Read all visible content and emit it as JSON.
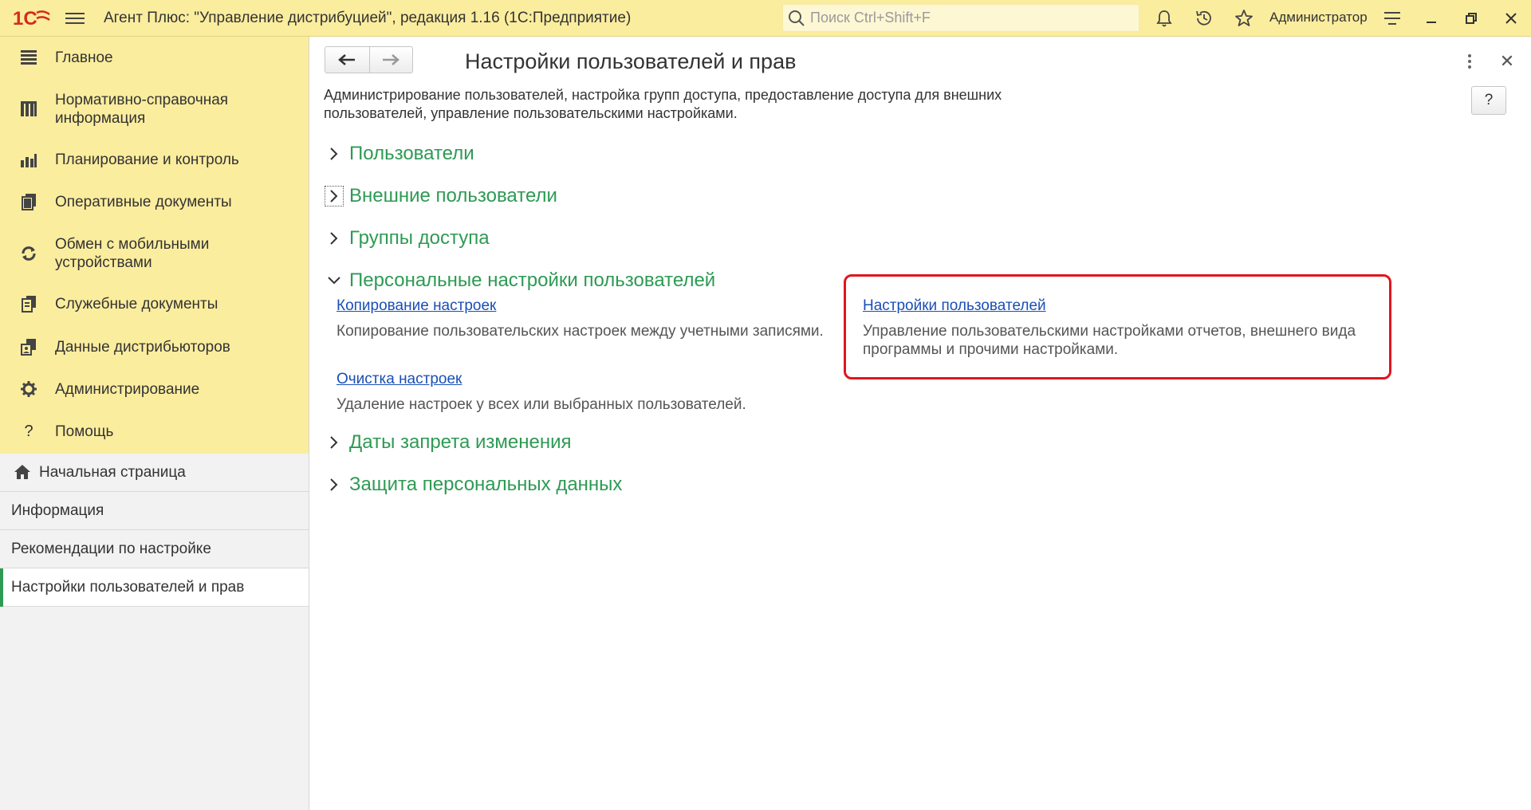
{
  "titlebar": {
    "app_title": "Агент Плюс: \"Управление дистрибуцией\", редакция 1.16  (1С:Предприятие)",
    "search_placeholder": "Поиск Ctrl+Shift+F",
    "user_name": "Администратор",
    "logo_text": "1С",
    "icons": [
      "bell-icon",
      "history-icon",
      "star-icon",
      "settings-lines-icon",
      "minimize-icon",
      "restore-icon",
      "close-icon"
    ]
  },
  "sidebar": {
    "sections": [
      {
        "label": "Главное",
        "icon": "list-icon"
      },
      {
        "label": "Нормативно-справочная информация",
        "icon": "catalog-icon"
      },
      {
        "label": "Планирование и контроль",
        "icon": "chart-icon"
      },
      {
        "label": "Оперативные документы",
        "icon": "documents-icon"
      },
      {
        "label": "Обмен с мобильными устройствами",
        "icon": "sync-icon"
      },
      {
        "label": "Служебные документы",
        "icon": "service-docs-icon"
      },
      {
        "label": "Данные дистрибьюторов",
        "icon": "distributor-icon"
      },
      {
        "label": "Администрирование",
        "icon": "gear-icon"
      },
      {
        "label": "Помощь",
        "icon": "question-icon"
      }
    ],
    "open_windows": [
      {
        "label": "Начальная страница",
        "icon": "home-icon"
      },
      {
        "label": "Информация"
      },
      {
        "label": "Рекомендации по настройке"
      },
      {
        "label": "Настройки пользователей и прав",
        "active": true
      }
    ]
  },
  "main": {
    "title": "Настройки пользователей и прав",
    "help_label": "?",
    "description": "Администрирование пользователей, настройка групп доступа, предоставление доступа для внешних пользователей, управление пользовательскими настройками.",
    "groups": [
      {
        "label": "Пользователи",
        "expanded": false
      },
      {
        "label": "Внешние пользователи",
        "expanded": false
      },
      {
        "label": "Группы доступа",
        "expanded": false
      },
      {
        "label": "Персональные настройки пользователей",
        "expanded": true
      },
      {
        "label": "Даты запрета изменения",
        "expanded": false
      },
      {
        "label": "Защита персональных данных",
        "expanded": false
      }
    ],
    "personal_settings": {
      "copy_link": "Копирование настроек",
      "copy_desc": "Копирование пользовательских настроек между учетными записями.",
      "clear_link": "Очистка настроек",
      "clear_desc": "Удаление настроек у всех или выбранных пользователей.",
      "user_settings_link": "Настройки пользователей",
      "user_settings_desc": "Управление пользовательскими настройками отчетов, внешнего вида программы и прочими настройками."
    }
  },
  "colors": {
    "titlebar_bg": "#fbed9e",
    "group_green": "#2e9a54",
    "link_blue": "#1a4fb6",
    "highlight_red": "#e0161e",
    "logo_red": "#d52b1e"
  }
}
